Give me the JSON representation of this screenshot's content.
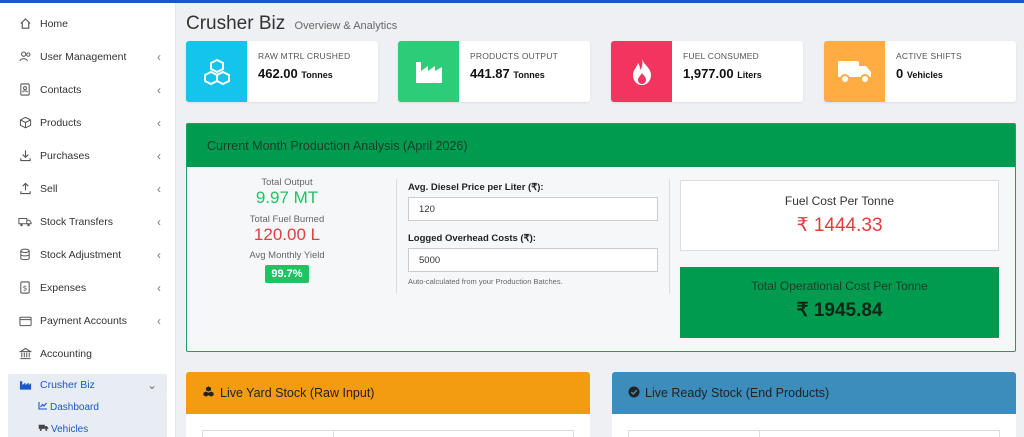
{
  "sidebar": {
    "items": [
      {
        "label": "Home",
        "icon": "home-icon",
        "chevron": false
      },
      {
        "label": "User Management",
        "icon": "users-icon",
        "chevron": true
      },
      {
        "label": "Contacts",
        "icon": "address-book-icon",
        "chevron": true
      },
      {
        "label": "Products",
        "icon": "cube-icon",
        "chevron": true
      },
      {
        "label": "Purchases",
        "icon": "download-icon",
        "chevron": true
      },
      {
        "label": "Sell",
        "icon": "upload-icon",
        "chevron": true
      },
      {
        "label": "Stock Transfers",
        "icon": "truck-icon",
        "chevron": true
      },
      {
        "label": "Stock Adjustment",
        "icon": "database-icon",
        "chevron": true
      },
      {
        "label": "Expenses",
        "icon": "receipt-icon",
        "chevron": true
      },
      {
        "label": "Payment Accounts",
        "icon": "wallet-icon",
        "chevron": true
      },
      {
        "label": "Accounting",
        "icon": "bank-icon",
        "chevron": false
      }
    ],
    "active": {
      "label": "Crusher Biz",
      "icon": "industry-icon"
    },
    "subitems": [
      {
        "label": "Dashboard",
        "icon": "chart-line-icon"
      },
      {
        "label": "Vehicles",
        "icon": "truck-icon"
      }
    ]
  },
  "header": {
    "title": "Crusher Biz",
    "subtitle": "Overview & Analytics"
  },
  "cards": [
    {
      "label": "RAW MTRL CRUSHED",
      "value": "462.00",
      "unit": "Tonnes",
      "icon": "cubes-icon",
      "color": "#15c4ea"
    },
    {
      "label": "PRODUCTS OUTPUT",
      "value": "441.87",
      "unit": "Tonnes",
      "icon": "industry-icon",
      "color": "#2ccc79"
    },
    {
      "label": "FUEL CONSUMED",
      "value": "1,977.00",
      "unit": "Liters",
      "icon": "fire-icon",
      "color": "#f2345e"
    },
    {
      "label": "ACTIVE SHIFTS",
      "value": "0",
      "unit": "Vehicles",
      "icon": "truck-icon",
      "color": "#ffad42"
    }
  ],
  "production": {
    "title": "Current Month Production Analysis (April 2026)",
    "total_output_label": "Total Output",
    "total_output": "9.97 MT",
    "fuel_burned_label": "Total Fuel Burned",
    "fuel_burned": "120.00 L",
    "yield_label": "Avg Monthly Yield",
    "yield": "99.7%",
    "diesel_label": "Avg. Diesel Price per Liter (₹):",
    "diesel_value": "120",
    "overhead_label": "Logged Overhead Costs (₹):",
    "overhead_value": "5000",
    "hint": "Auto-calculated from your Production Batches.",
    "fuel_cost_title": "Fuel Cost Per Tonne",
    "fuel_cost": "₹ 1444.33",
    "total_cost_title": "Total Operational Cost Per Tonne",
    "total_cost": "₹ 1945.84"
  },
  "stock": [
    {
      "title": "Live Yard Stock (Raw Input)",
      "icon": "cubes-icon",
      "color": "#f39c12"
    },
    {
      "title": "Live Ready Stock (End Products)",
      "icon": "check-circle-icon",
      "color": "#3c8dbc"
    }
  ],
  "colors": {
    "accent": "#1a57c9",
    "green": "#009b4e",
    "red": "#e23d3d"
  }
}
